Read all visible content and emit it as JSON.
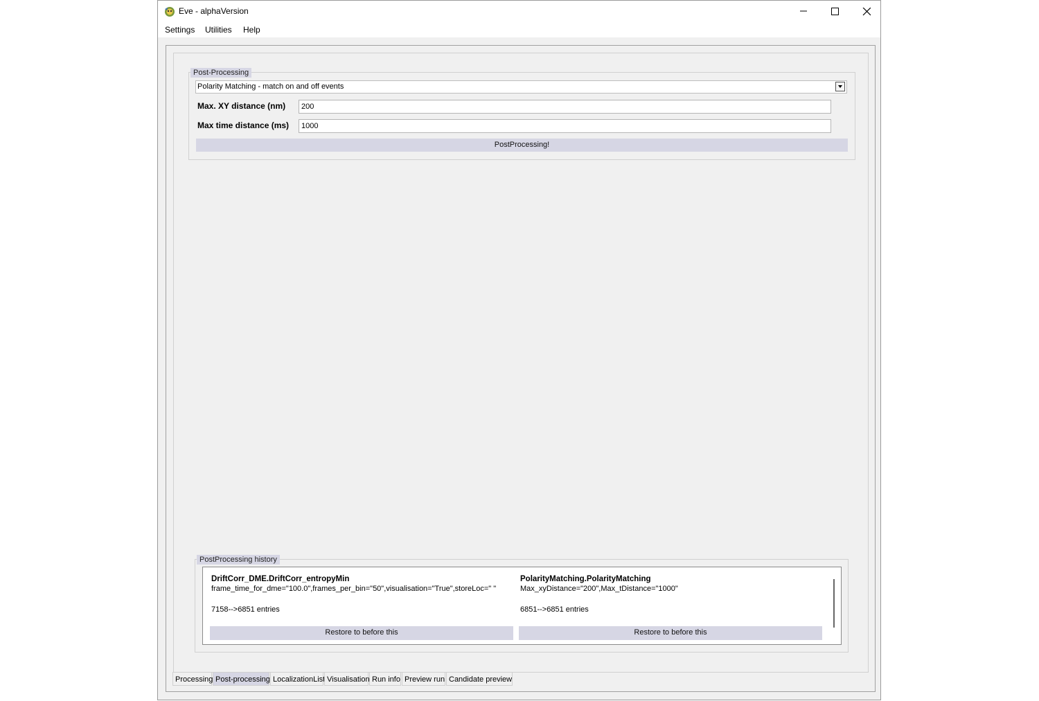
{
  "window": {
    "title": "Eve - alphaVersion"
  },
  "menubar": {
    "items": [
      "Settings",
      "Utilities",
      "Help"
    ]
  },
  "postprocessing": {
    "group_title": "Post-Processing",
    "method_selected": "Polarity Matching - match on and off events",
    "fields": [
      {
        "label": "Max. XY distance (nm)",
        "value": "200"
      },
      {
        "label": "Max time distance (ms)",
        "value": "1000"
      }
    ],
    "run_button": "PostProcessing!"
  },
  "history": {
    "group_title": "PostProcessing history",
    "entries": [
      {
        "title": "DriftCorr_DME.DriftCorr_entropyMin",
        "params": "frame_time_for_dme=\"100.0\",frames_per_bin=\"50\",visualisation=\"True\",storeLoc=\" \"",
        "entries": "7158-->6851 entries",
        "restore_label": "Restore to before this"
      },
      {
        "title": "PolarityMatching.PolarityMatching",
        "params": "Max_xyDistance=\"200\",Max_tDistance=\"1000\"",
        "entries": "6851-->6851 entries",
        "restore_label": "Restore to before this"
      }
    ]
  },
  "tabs": [
    "Processing",
    "Post-processing",
    "LocalizationList",
    "Visualisation",
    "Run info",
    "Preview run",
    "Candidate preview"
  ],
  "active_tab": "Post-processing"
}
